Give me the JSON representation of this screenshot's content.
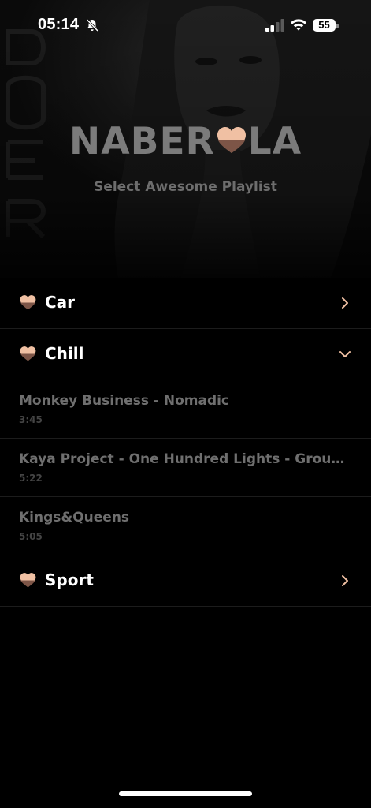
{
  "status_bar": {
    "time": "05:14",
    "battery": "55",
    "icons": [
      "bell-off-icon",
      "signal-icon",
      "wifi-icon",
      "battery-icon"
    ]
  },
  "header": {
    "logo_left": "NABER",
    "logo_right": "LA",
    "logo_icon": "heart-icon",
    "subtitle": "Select Awesome Playlist"
  },
  "colors": {
    "accent": "#f0c0a3",
    "accent_dark": "#7d5547",
    "logo_text": "#7b7b7b",
    "track_text": "#6f6f6f",
    "duration_text": "#444444",
    "background": "#000000"
  },
  "playlists": [
    {
      "name": "Car",
      "expanded": false,
      "chevron": "chevron-right-icon",
      "tracks": []
    },
    {
      "name": "Chill",
      "expanded": true,
      "chevron": "chevron-down-icon",
      "tracks": [
        {
          "title": "Monkey Business - Nomadic",
          "duration": "3:45"
        },
        {
          "title": "Kaya Project - One Hundred Lights - Grouch...",
          "duration": "5:22"
        },
        {
          "title": "Kings&Queens",
          "duration": "5:05"
        }
      ]
    },
    {
      "name": "Sport",
      "expanded": false,
      "chevron": "chevron-right-icon",
      "tracks": []
    }
  ]
}
